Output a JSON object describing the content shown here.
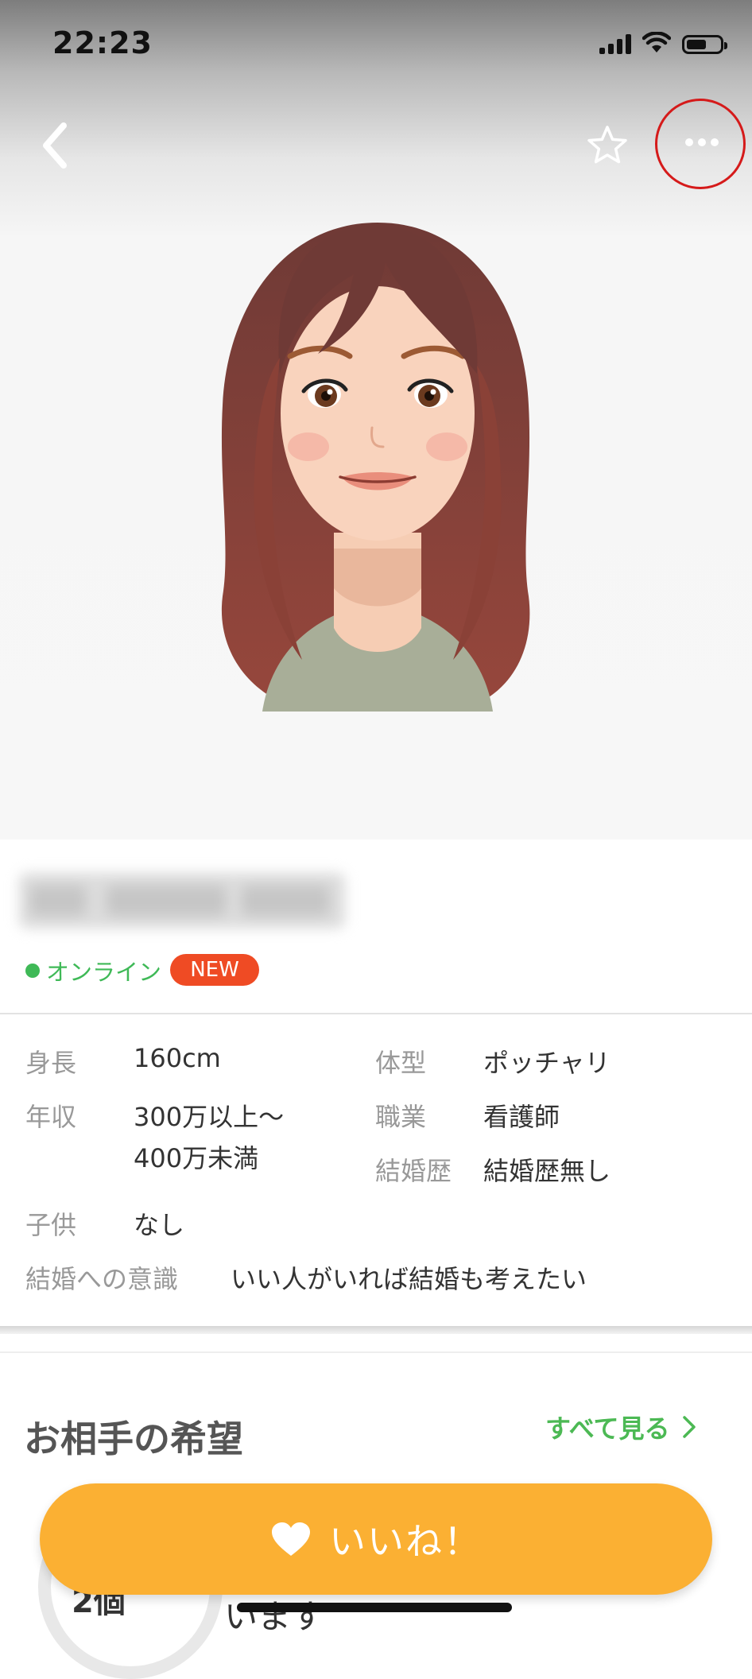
{
  "status_bar": {
    "time": "22:23"
  },
  "profile": {
    "online_label": "オンライン",
    "new_badge": "NEW",
    "details": {
      "height": {
        "label": "身長",
        "value": "160cm"
      },
      "body_type": {
        "label": "体型",
        "value": "ポッチャリ"
      },
      "income": {
        "label": "年収",
        "value_line1": "300万以上〜",
        "value_line2": "400万未満"
      },
      "occupation": {
        "label": "職業",
        "value": "看護師"
      },
      "marriage_history": {
        "label": "結婚歴",
        "value": "結婚歴無し"
      },
      "children": {
        "label": "子供",
        "value": "なし"
      },
      "marriage_intent": {
        "label": "結婚への意識",
        "value": "いい人がいれば結婚も考えたい"
      }
    }
  },
  "preferences": {
    "title": "お相手の希望",
    "see_all": "すべて見る",
    "count_text": "2個",
    "bottom_text": "います"
  },
  "like_button": {
    "label": "いいね！"
  },
  "icons": {
    "back": "chevron-left-icon",
    "favorite": "star-outline-icon",
    "more": "more-horizontal-icon",
    "like": "heart-icon",
    "see_all_arrow": "chevron-right-icon"
  },
  "colors": {
    "accent_orange": "#fbb033",
    "online_green": "#3fb957",
    "badge_red": "#ef4b24",
    "highlight_circle": "#d51a1a"
  }
}
